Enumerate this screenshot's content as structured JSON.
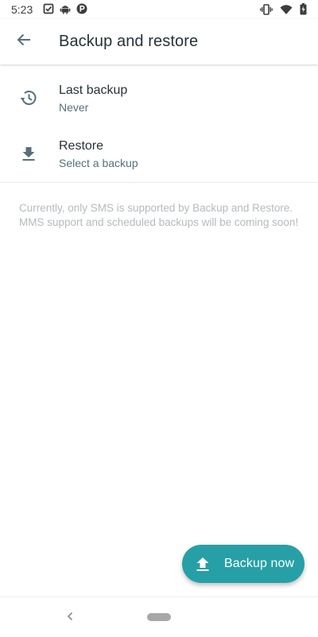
{
  "status_bar": {
    "time": "5:23",
    "left_icons": [
      "task-done-icon",
      "android-icon",
      "parking-icon"
    ],
    "right_icons": [
      "vibrate-icon",
      "wifi-icon",
      "battery-icon"
    ]
  },
  "toolbar": {
    "title": "Backup and restore",
    "back_icon": "arrow-back-icon"
  },
  "settings": {
    "items": [
      {
        "icon": "history-icon",
        "title": "Last backup",
        "summary": "Never"
      },
      {
        "icon": "download-icon",
        "title": "Restore",
        "summary": "Select a backup"
      }
    ],
    "info": "Currently, only SMS is supported by Backup and Restore. MMS support and scheduled backups will be coming soon!"
  },
  "fab": {
    "label": "Backup now",
    "icon": "upload-icon",
    "color": "#26a0a6"
  },
  "nav_bar": {
    "back_icon": "nav-back-icon",
    "home_icon": "nav-home-pill"
  },
  "colors": {
    "text_primary": "#263238",
    "text_secondary": "#56707a",
    "text_hint": "#b5babd",
    "accent": "#26a0a6"
  }
}
